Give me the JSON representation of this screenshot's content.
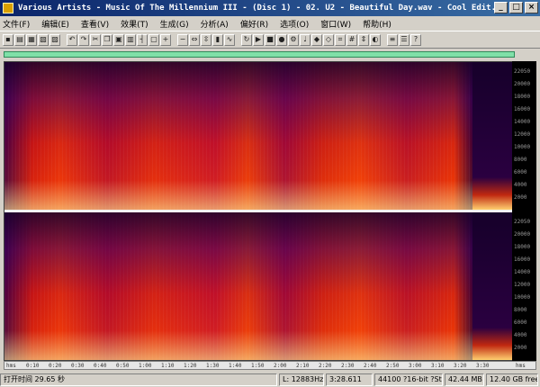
{
  "window": {
    "title": "Various Artists - Music Of The Millennium III - (Disc 1) - 02. U2 - Beautiful Day.wav - Cool Edit...",
    "buttons": {
      "minimize": "_",
      "maximize": "□",
      "close": "×"
    }
  },
  "menu": [
    {
      "label": "文件(F)"
    },
    {
      "label": "编辑(E)"
    },
    {
      "label": "查看(V)"
    },
    {
      "label": "效果(T)"
    },
    {
      "label": "生成(G)"
    },
    {
      "label": "分析(A)"
    },
    {
      "label": "偏好(R)"
    },
    {
      "label": "选项(O)"
    },
    {
      "label": "窗口(W)"
    },
    {
      "label": "帮助(H)"
    }
  ],
  "toolbar": {
    "icons": [
      "new",
      "open",
      "save",
      "save-as",
      "close",
      "undo",
      "redo",
      "cut",
      "copy",
      "paste",
      "mix-paste",
      "trim",
      "select-all",
      "zoom-in",
      "zoom-out",
      "zoom-full",
      "zoom-sel",
      "spectral",
      "waveform",
      "loop",
      "play",
      "stop",
      "record",
      "settings",
      "metronome",
      "marker",
      "region",
      "snap",
      "grid",
      "scroll",
      "cue",
      "mix",
      "multitrack",
      "help"
    ]
  },
  "view": {
    "mode": "spectral",
    "colors": {
      "low": "#1a0030",
      "mid": "#d8200e",
      "high": "#ffe8a0",
      "overview": "#7fe0a8"
    }
  },
  "freq_scale": {
    "channel1": [
      "22050",
      "20000",
      "18000",
      "16000",
      "14000",
      "12000",
      "10000",
      "8000",
      "6000",
      "4000",
      "2000"
    ],
    "channel2": [
      "22050",
      "20000",
      "18000",
      "16000",
      "14000",
      "12000",
      "10000",
      "8000",
      "6000",
      "4000",
      "2000"
    ]
  },
  "timeline": {
    "labels": [
      "hms",
      "0:10",
      "0:20",
      "0:30",
      "0:40",
      "0:50",
      "1:00",
      "1:10",
      "1:20",
      "1:30",
      "1:40",
      "1:50",
      "2:00",
      "2:10",
      "2:20",
      "2:30",
      "2:40",
      "2:50",
      "3:00",
      "3:10",
      "3:20",
      "3:30",
      "hms"
    ]
  },
  "status": {
    "open_time": "打开时间 29.65 秒",
    "left": "L: 12883Hz @",
    "position": "3:28.611",
    "format": "44100 ?16-bit ?Stereo",
    "size": "42.44 MB",
    "free": "12.40 GB free"
  }
}
